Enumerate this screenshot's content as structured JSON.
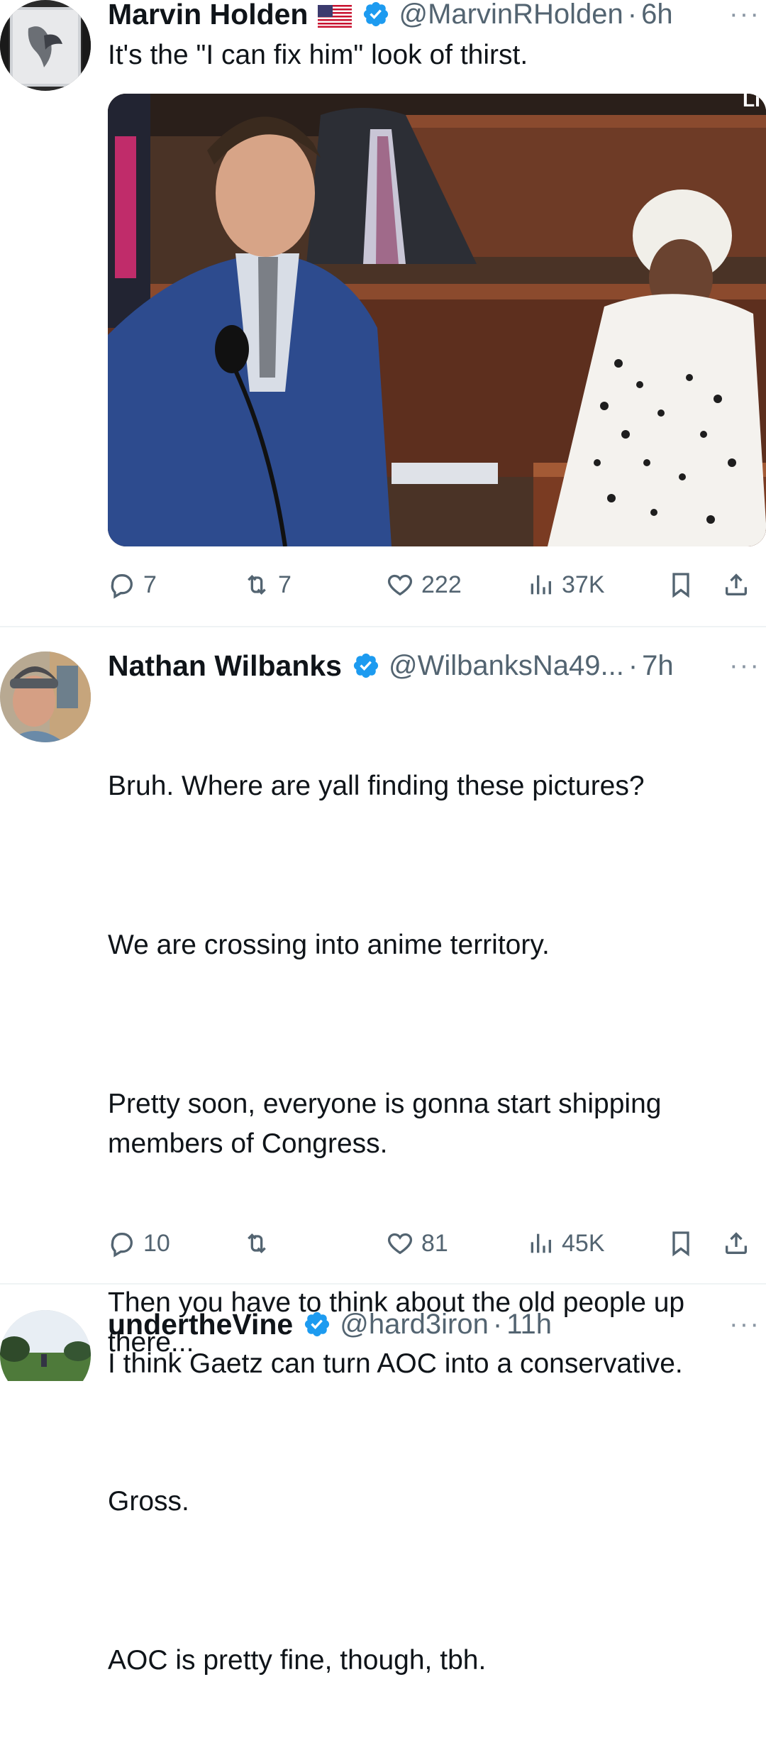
{
  "tweets": [
    {
      "name": "Marvin Holden",
      "flag": "🇺🇸",
      "handle": "@MarvinRHolden",
      "time": "6h",
      "more": "···",
      "text": "It's the \"I can fix him\" look of thirst.",
      "actions": {
        "replies": "7",
        "retweets": "7",
        "likes": "222",
        "views": "37K"
      }
    },
    {
      "name": "Nathan Wilbanks",
      "handle": "@WilbanksNa49...",
      "time": "7h",
      "more": "···",
      "paragraphs": [
        "Bruh. Where are yall finding these pictures?",
        "We are crossing into anime territory.",
        "Pretty soon, everyone is gonna start shipping members of Congress.",
        "Then you have to think about the old people up there...",
        "Gross.",
        "AOC is pretty fine, though, tbh."
      ],
      "actions": {
        "replies": "10",
        "retweets": "",
        "likes": "81",
        "views": "45K"
      }
    },
    {
      "name": "undertheVine",
      "handle": "@hard3iron",
      "time": "11h",
      "more": "···",
      "text": "I think Gaetz can turn AOC into a conservative."
    }
  ],
  "media_corner_text": "LI",
  "colors": {
    "verified": "#1d9bf0",
    "secondary": "#536471",
    "divider": "#eff3f4"
  },
  "icons": [
    "reply-icon",
    "retweet-icon",
    "like-icon",
    "views-icon",
    "bookmark-icon",
    "share-icon",
    "verified-badge-icon",
    "more-icon"
  ]
}
